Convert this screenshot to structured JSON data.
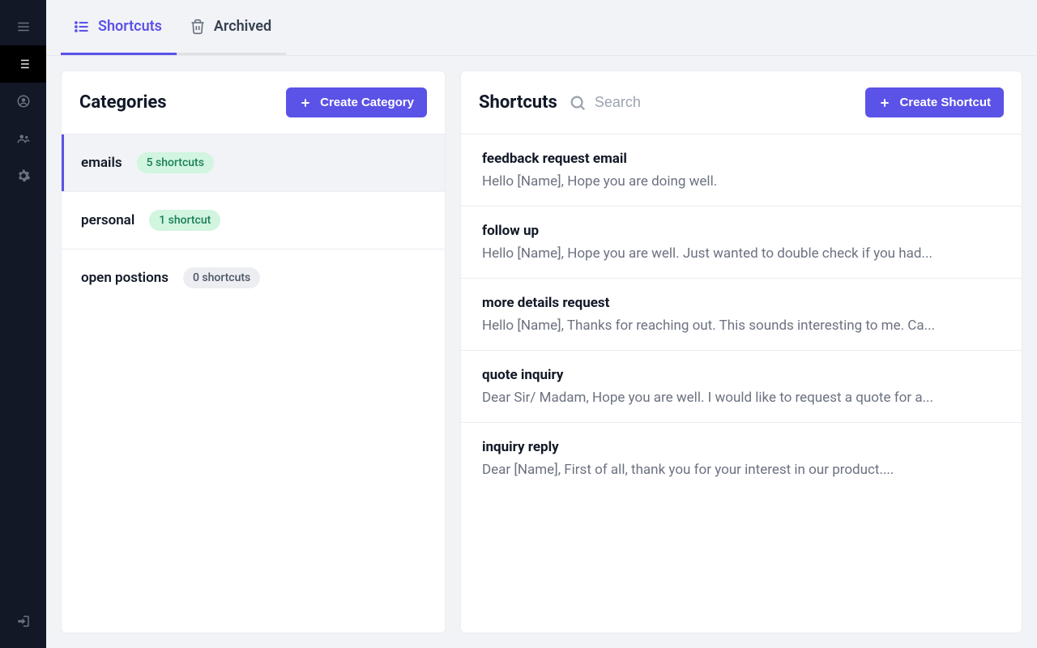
{
  "tabs": {
    "shortcuts": "Shortcuts",
    "archived": "Archived"
  },
  "categories": {
    "heading": "Categories",
    "create_button": "Create Category",
    "items": [
      {
        "name": "emails",
        "count_label": "5 shortcuts",
        "active": true,
        "badge_style": "green"
      },
      {
        "name": "personal",
        "count_label": "1 shortcut",
        "active": false,
        "badge_style": "green"
      },
      {
        "name": "open postions",
        "count_label": "0 shortcuts",
        "active": false,
        "badge_style": "gray"
      }
    ]
  },
  "shortcuts": {
    "heading": "Shortcuts",
    "search_placeholder": "Search",
    "create_button": "Create Shortcut",
    "items": [
      {
        "title": "feedback request email",
        "preview": "Hello [Name], Hope you are doing well."
      },
      {
        "title": "follow up",
        "preview": "Hello [Name], Hope you are well. Just wanted to double check if you had..."
      },
      {
        "title": "more details request",
        "preview": "Hello [Name], Thanks for reaching out. This sounds interesting to me. Ca..."
      },
      {
        "title": "quote inquiry",
        "preview": "Dear Sir/ Madam, Hope you are well. I would like to request a quote for a..."
      },
      {
        "title": "inquiry reply",
        "preview": "Dear [Name], First of all, thank you for your interest in our product...."
      }
    ]
  }
}
